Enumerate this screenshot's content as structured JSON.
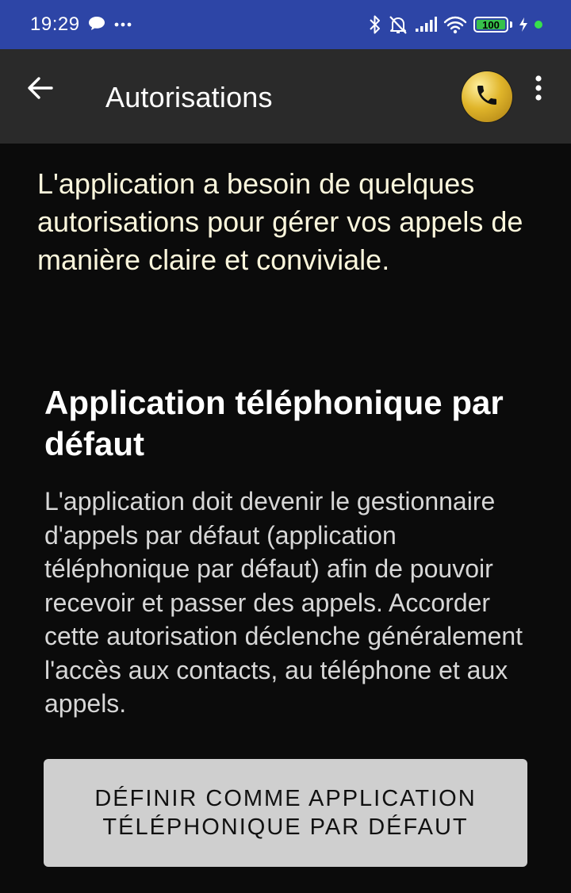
{
  "status_bar": {
    "time": "19:29",
    "icons": [
      "chat-bubble-icon",
      "more-dots-icon",
      "bluetooth-icon",
      "silent-bell-icon",
      "signal-icon",
      "wifi-icon",
      "battery-icon",
      "charging-icon"
    ],
    "battery_level": "100",
    "battery_fraction": 1.0,
    "color": "#2d45a6"
  },
  "app_bar": {
    "back_icon": "arrow-left-icon",
    "title": "Autorisations",
    "avatar_icon": "phone-icon",
    "menu_icon": "more-vert-icon"
  },
  "content": {
    "intro": "L'application a besoin de quelques autorisations pour gérer vos appels de manière claire et conviviale.",
    "section_title": "Application téléphonique par défaut",
    "section_description": "L'application doit devenir le gestionnaire d'appels par défaut (application téléphonique par défaut) afin de pouvoir recevoir et passer des appels. Accorder cette autorisation déclenche généralement l'accès aux contacts, au téléphone et aux appels.",
    "button_label": "DÉFINIR COMME APPLICATION TÉLÉPHONIQUE PAR DÉFAUT"
  }
}
